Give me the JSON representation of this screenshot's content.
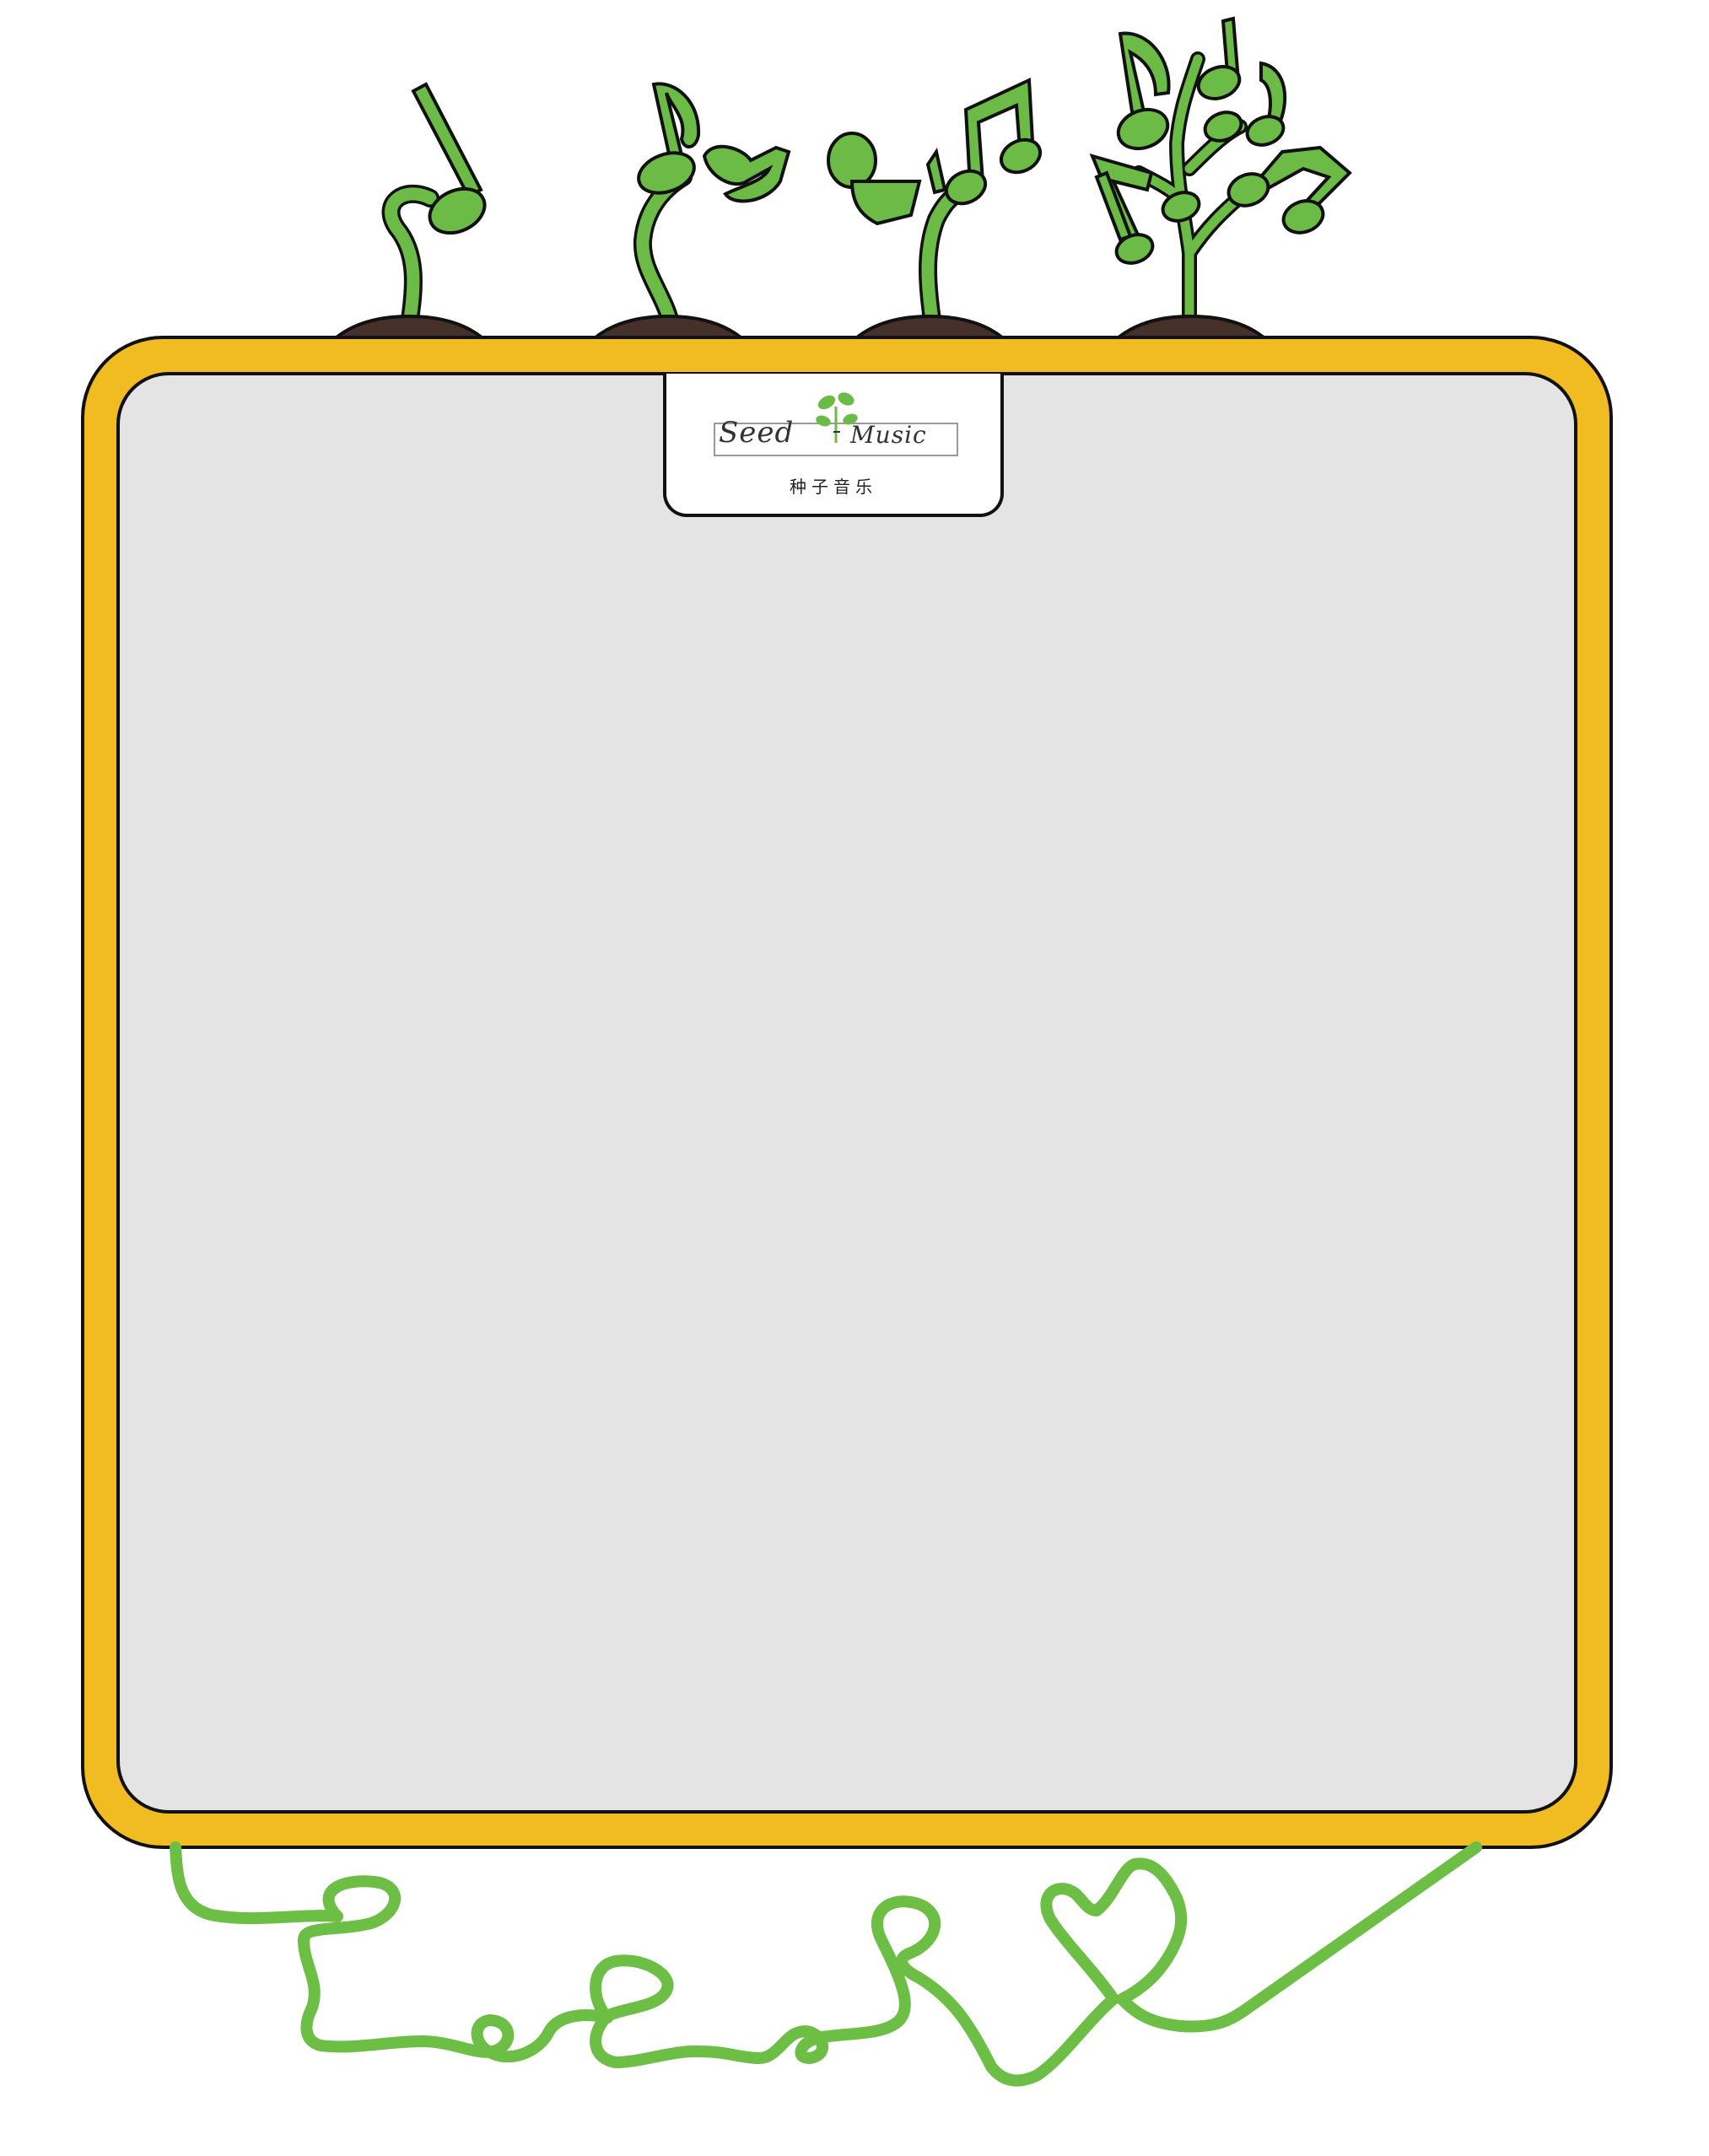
{
  "logo": {
    "line_left": "Seed",
    "line_right": "Music",
    "subtitle": "种子音乐"
  },
  "colors": {
    "frame_orange": "#F0BC22",
    "panel_gray": "#E4E4E4",
    "outline": "#111111",
    "sprout_green": "#6CBB47",
    "soil_brown": "#45302A",
    "vine_green": "#6CBE45"
  },
  "decorations": {
    "sprouts": [
      "music-note-sprout-1",
      "music-note-sprout-2",
      "music-note-sprout-3",
      "music-note-tree"
    ],
    "vine": "vine-letters"
  }
}
